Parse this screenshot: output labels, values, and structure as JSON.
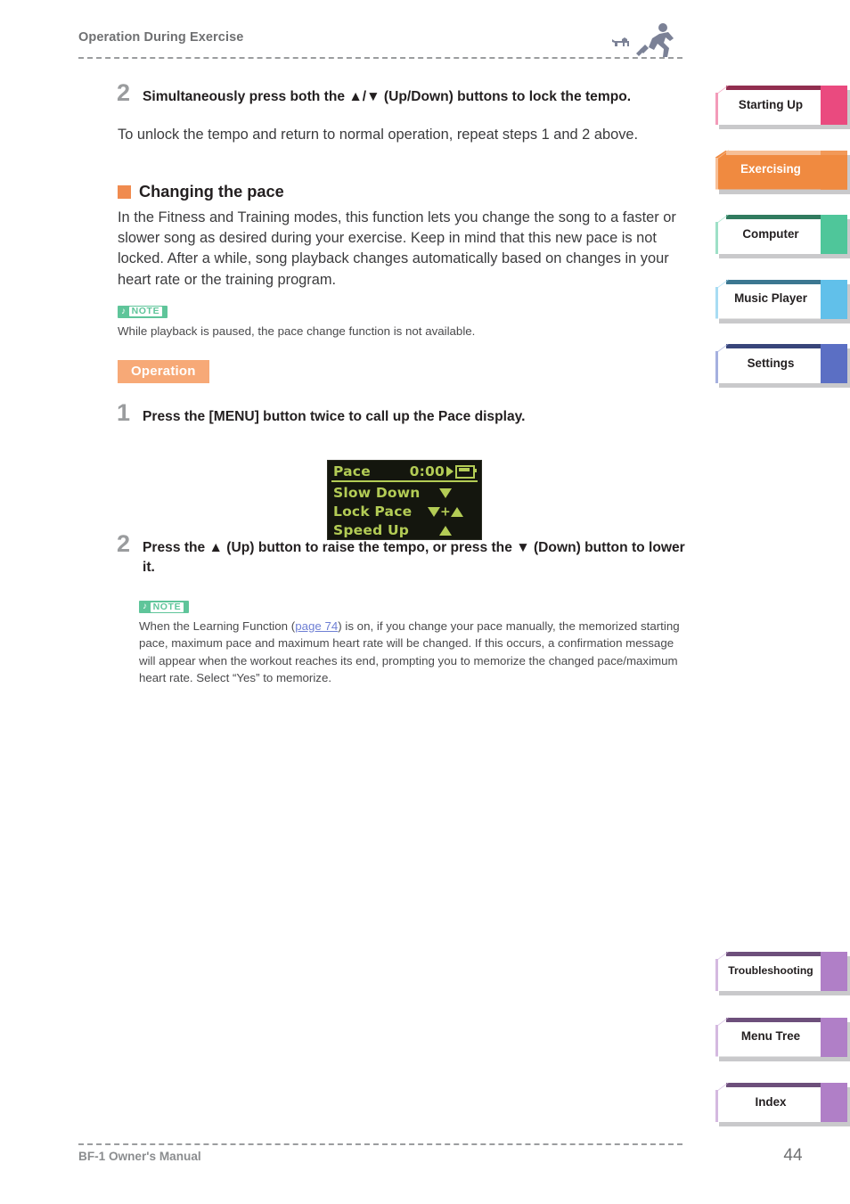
{
  "header": {
    "title": "Operation During Exercise",
    "icons": [
      "dog-icon",
      "runner-icon"
    ]
  },
  "main": {
    "step_a": {
      "number": "2",
      "text": "Simultaneously press both the ▲/▼ (Up/Down) buttons to lock the tempo."
    },
    "paragraph_a": "To unlock the tempo and return to normal operation, repeat steps 1 and 2 above.",
    "section": {
      "heading": "Changing the pace",
      "bullet_color": "#f08b4f",
      "body": "In the Fitness and Training modes, this function lets you change the song to a faster or slower song as desired during your exercise. Keep in mind that this new pace is not locked. After a while, song playback changes automatically based on changes in your heart rate or the training program."
    },
    "note_1": {
      "badge_music": "♪",
      "badge_label": "NOTE",
      "badge_color": "#5fc59a",
      "text": "While playback is paused, the pace change function is not available."
    },
    "operation_badge": {
      "label": "Operation",
      "color": "#f7a977"
    },
    "step_1": {
      "number": "1",
      "text": "Press the [MENU] button twice to call up the Pace display."
    },
    "step_2": {
      "number": "2",
      "text": "Press the ▲ (Up) button to raise the tempo, or press the ▼ (Down) button to lower it."
    },
    "note_2": {
      "badge_music": "♪",
      "badge_label": "NOTE",
      "text_part1": "When the Learning Function (",
      "link_text": "page 74",
      "link_color": "#6e7fd4",
      "text_part2": ") is on, if you change your pace manually, the memorized starting pace, maximum pace and maximum heart rate will be changed. If this occurs, a confirmation message will appear when the workout reaches its end, prompting you to memorize the changed pace/maximum heart rate. Select “Yes” to memorize."
    }
  },
  "lcd": {
    "background": "#14160e",
    "text_color": "#b3cc55",
    "rows": [
      {
        "label": "Pace",
        "value": "0:00",
        "icons": [
          "play-icon",
          "battery-icon"
        ]
      },
      {
        "label": "Slow Down",
        "symbol": "down-triangle"
      },
      {
        "label": "Lock Pace",
        "symbol": "down-plus-up-triangle"
      },
      {
        "label": "Speed Up",
        "symbol": "up-triangle"
      }
    ]
  },
  "sidebar": {
    "top_tabs": [
      {
        "label": "Starting Up",
        "color": "#ea4a7f",
        "active": false
      },
      {
        "label": "Exercising",
        "color": "#f08a40",
        "active": true
      },
      {
        "label": "Computer",
        "color": "#4fc69a",
        "active": false
      },
      {
        "label": "Music Player",
        "color": "#61c0ea",
        "active": false
      },
      {
        "label": "Settings",
        "color": "#5b6fc4",
        "active": false
      }
    ],
    "bottom_tabs": [
      {
        "label": "Troubleshooting",
        "color": "#b07fc7",
        "active": false
      },
      {
        "label": "Menu Tree",
        "color": "#b07fc7",
        "active": false
      },
      {
        "label": "Index",
        "color": "#b07fc7",
        "active": false
      }
    ]
  },
  "footer": {
    "manual": "BF-1 Owner's Manual",
    "page": "44"
  }
}
